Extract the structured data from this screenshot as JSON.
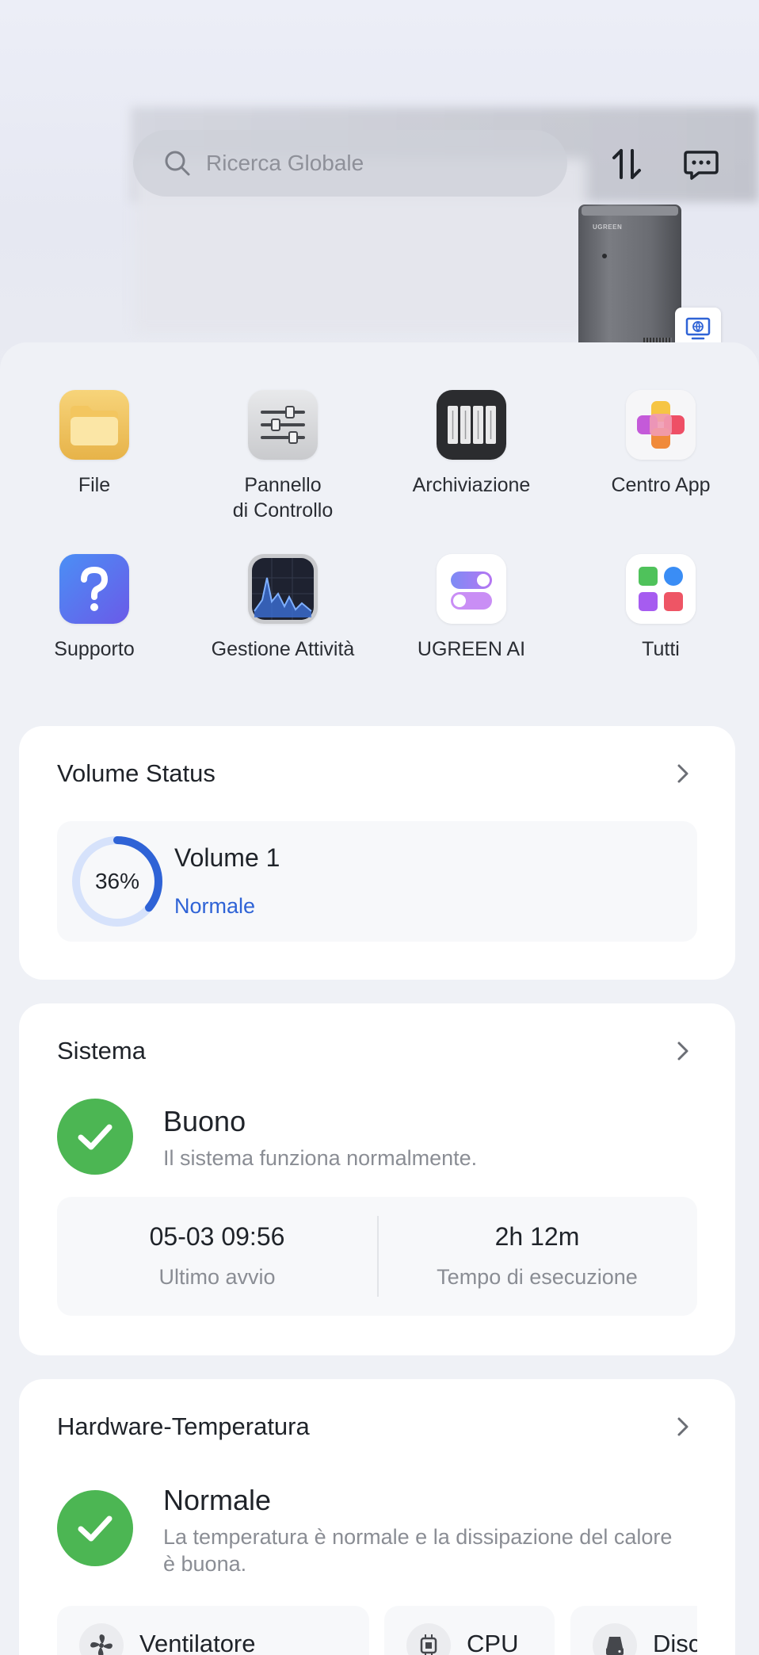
{
  "header": {
    "search_placeholder": "Ricerca Globale",
    "nas_brand": "UGREEN"
  },
  "apps": [
    {
      "label": "File",
      "icon": "folder-icon"
    },
    {
      "label": "Pannello\ndi Controllo",
      "icon": "sliders-icon"
    },
    {
      "label": "Archiviazione",
      "icon": "drives-icon"
    },
    {
      "label": "Centro App",
      "icon": "app-center-icon"
    },
    {
      "label": "Supporto",
      "icon": "help-icon"
    },
    {
      "label": "Gestione Attività",
      "icon": "activity-monitor-icon"
    },
    {
      "label": "UGREEN AI",
      "icon": "toggles-icon"
    },
    {
      "label": "Tutti",
      "icon": "grid-icon"
    }
  ],
  "volume_status": {
    "title": "Volume Status",
    "percent_label": "36%",
    "usage_fraction": 0.36,
    "name": "Volume 1",
    "state": "Normale"
  },
  "system": {
    "title": "Sistema",
    "status": "Buono",
    "description": "Il sistema funziona normalmente.",
    "last_boot_value": "05-03 09:56",
    "last_boot_label": "Ultimo avvio",
    "uptime_value": "2h 12m",
    "uptime_label": "Tempo di esecuzione"
  },
  "hardware": {
    "title": "Hardware-Temperatura",
    "status": "Normale",
    "description": "La temperatura è normale e la dissipazione del calore è buona.",
    "tiles": [
      {
        "label": "Ventilatore",
        "icon": "fan-icon"
      },
      {
        "label": "CPU",
        "icon": "cpu-icon"
      },
      {
        "label": "Disco",
        "icon": "disk-icon"
      }
    ]
  },
  "colors": {
    "accent": "#2f63d6",
    "success": "#4cb653",
    "ring_track": "#d6e2fb"
  }
}
